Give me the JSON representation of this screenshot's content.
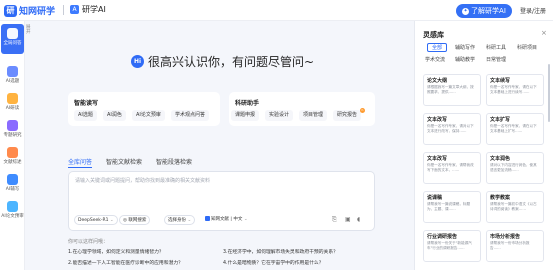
{
  "header": {
    "logo_text": "知网研学",
    "subbrand_text": "研学AI",
    "learn_button": "了解研学AI",
    "login_link": "登录/注册"
  },
  "sidebar": {
    "collapse_label": "展开",
    "items": [
      {
        "label": "全局问答",
        "icon": "chat-icon",
        "color": "#ffffff"
      },
      {
        "label": "AI选题",
        "icon": "topic-icon",
        "color": "#6b8cff"
      },
      {
        "label": "AI研读",
        "icon": "read-icon",
        "color": "#ffb340"
      },
      {
        "label": "专题研究",
        "icon": "research-icon",
        "color": "#8a6bff"
      },
      {
        "label": "文献综述",
        "icon": "review-icon",
        "color": "#ff8a4c"
      },
      {
        "label": "AI辅写",
        "icon": "write-icon",
        "color": "#3f8cff"
      },
      {
        "label": "AI论文预审",
        "icon": "precheck-icon",
        "color": "#4cb5ff"
      }
    ]
  },
  "hero": {
    "badge": "Hi",
    "text": "很高兴认识你，有问题尽管问~"
  },
  "smart_read": {
    "title": "智能读写",
    "chips": [
      "AI选题",
      "AI润色",
      "AI论文预审",
      "学术观点问答"
    ]
  },
  "research": {
    "title": "科研助手",
    "chips": [
      "课题申报",
      "实验设计",
      "项目管理",
      "研究报告"
    ],
    "hot_badge": "h"
  },
  "tabs": [
    "全库问答",
    "智能文献检索",
    "智能段落检索"
  ],
  "input": {
    "placeholder": "请输入关键词或问题提问，帮助你找到最准确的相关文献资料",
    "model": "DeepSeek-R1",
    "deep_think": "联网搜索",
    "identity": "选择身份",
    "kb_label": "知网文献 | 中文"
  },
  "suggestions": {
    "title": "你可以这样问哦：",
    "items": [
      "1.在心理学领域，如何定义和测量情绪智力？",
      "3.在经济学中，如何理解市场失灵和政府干预的关系？",
      "2.能否描述一下人工智能在医疗诊断中的应用和潜力？",
      "4.什么是暗物质？它在宇宙学中的作用是什么？"
    ]
  },
  "panel": {
    "title": "灵感库",
    "close": "×",
    "tabs": [
      "全部",
      "辅助写作",
      "科研工具",
      "科研项目",
      "学术交流",
      "辅助教学",
      "日常管理"
    ],
    "cards": [
      {
        "title": "论文大纲",
        "desc": "请根据我写一篇文章大纲，按照要求，提供……"
      },
      {
        "title": "文本续写",
        "desc": "你是一名写作专家，请在以下文本基础上进行续写……"
      },
      {
        "title": "文本改写",
        "desc": "你是一名写作专家，请对以下文本进行改写，保持……"
      },
      {
        "title": "文本扩写",
        "desc": "你是一名写作专家，请在以下文本基础上扩写……"
      },
      {
        "title": "文本改写",
        "desc": "你是一名写作专家，请帮我改写下面的文本，……"
      },
      {
        "title": "文本润色",
        "desc": "请对以下内容进行润色，使其语言更加流畅……"
      },
      {
        "title": "说课稿",
        "desc": "请帮我写一篇说课稿，标题为，主题、课……"
      },
      {
        "title": "教学教案",
        "desc": "请帮我写一篇初中语文《以古诗词的阅读》教案……"
      },
      {
        "title": "行业调研报告",
        "desc": "请帮我写一份关于\"新能源汽车\"行业的调研报告……"
      },
      {
        "title": "市场分析报告",
        "desc": "请帮我写一份市场分析报告……"
      }
    ]
  }
}
